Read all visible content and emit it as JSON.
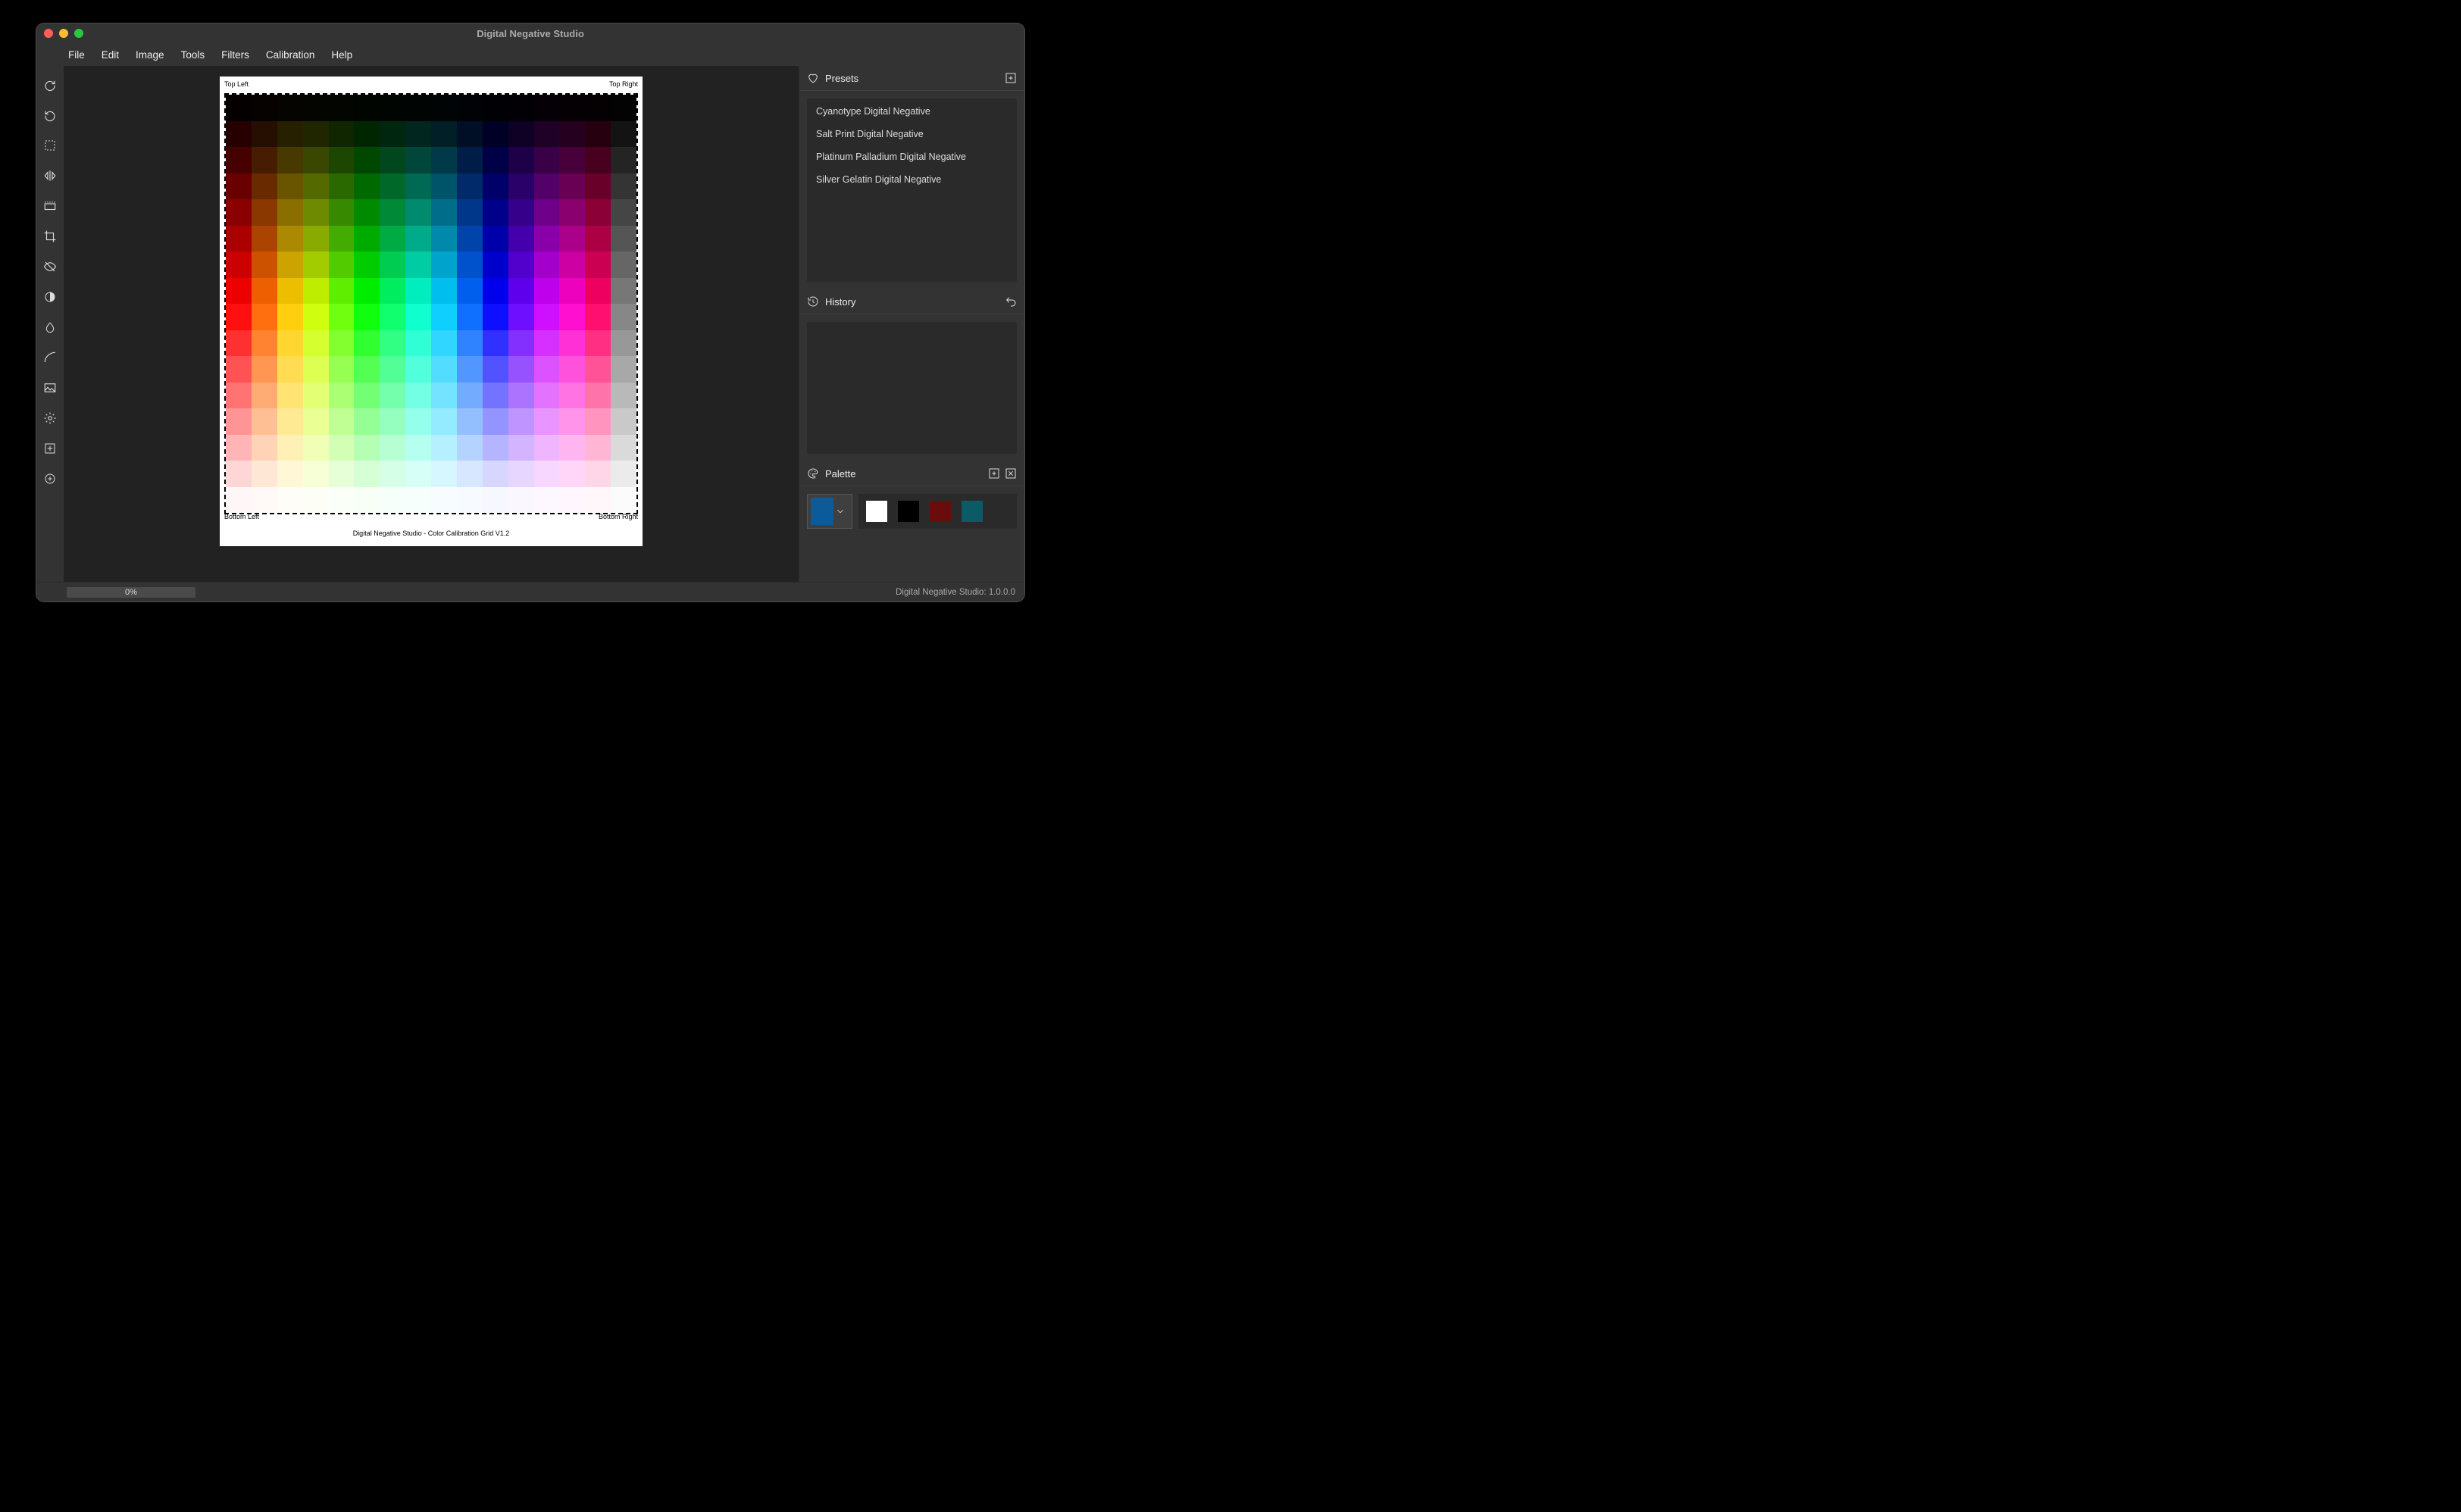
{
  "window": {
    "title": "Digital Negative Studio"
  },
  "menubar": [
    "File",
    "Edit",
    "Image",
    "Tools",
    "Filters",
    "Calibration",
    "Help"
  ],
  "tools": [
    {
      "name": "rotate-cw-icon"
    },
    {
      "name": "rotate-ccw-icon"
    },
    {
      "name": "marquee-icon"
    },
    {
      "name": "flip-horizontal-icon"
    },
    {
      "name": "resize-icon"
    },
    {
      "name": "crop-icon"
    },
    {
      "name": "visibility-off-icon"
    },
    {
      "name": "contrast-icon"
    },
    {
      "name": "droplet-icon"
    },
    {
      "name": "curve-icon"
    },
    {
      "name": "image-icon"
    },
    {
      "name": "gear-icon"
    },
    {
      "name": "grid-plus-icon"
    },
    {
      "name": "add-circle-icon"
    }
  ],
  "canvas": {
    "corners": {
      "tl": "Top Left",
      "tr": "Top Right",
      "bl": "Bottom Left",
      "br": "Bottom Right"
    },
    "caption": "Digital Negative Studio - Color Calibration Grid V1.2",
    "hue_columns_deg": [
      0,
      24,
      48,
      72,
      96,
      120,
      144,
      168,
      192,
      216,
      240,
      264,
      288,
      312,
      336,
      360
    ],
    "lightness_rows_pct": [
      1,
      7.5,
      14,
      20.5,
      27,
      33.5,
      40,
      46.5,
      53,
      59.5,
      66,
      72.5,
      79,
      85.5,
      92,
      98.5
    ]
  },
  "presets": {
    "title": "Presets",
    "items": [
      "Cyanotype Digital Negative",
      "Salt Print Digital Negative",
      "Platinum Palladium Digital Negative",
      "Silver Gelatin Digital Negative"
    ]
  },
  "history": {
    "title": "History"
  },
  "palette": {
    "title": "Palette",
    "current": "#0b5a99",
    "swatches": [
      "#ffffff",
      "#000000",
      "#6a0c0c",
      "#0b5a66"
    ]
  },
  "statusbar": {
    "progress_label": "0%",
    "version_label": "Digital Negative Studio: 1.0.0.0"
  }
}
